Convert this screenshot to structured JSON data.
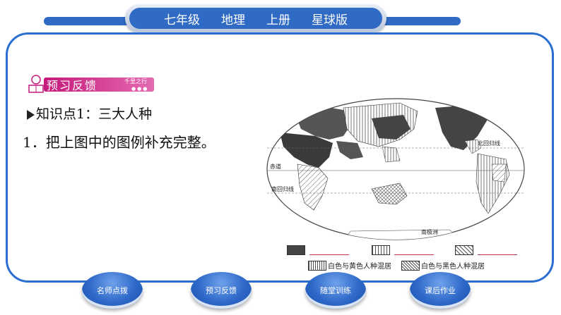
{
  "header": {
    "items": [
      "七年级",
      "地理",
      "上册",
      "星球版"
    ]
  },
  "section": {
    "title": "预习反馈",
    "subtitle": "千里之行",
    "dots": "●●●"
  },
  "content": {
    "knowledge_point": "知识点1：三大人种",
    "question": "1．把上图中的图例补充完整。"
  },
  "map": {
    "labels": {
      "north_tropic": "北回归线",
      "equator": "赤道",
      "south_tropic": "南回归线",
      "antarctica": "南极洲"
    }
  },
  "legend": {
    "mixed_white_yellow": "白色与黄色人种混居",
    "mixed_white_black": "白色与黑色人种混居"
  },
  "nav_buttons": [
    "名师点拨",
    "预习反馈",
    "随堂训练",
    "课后作业"
  ],
  "colors": {
    "accent_blue": "#2f6ac4",
    "badge_magenta": "#c51a7c"
  }
}
